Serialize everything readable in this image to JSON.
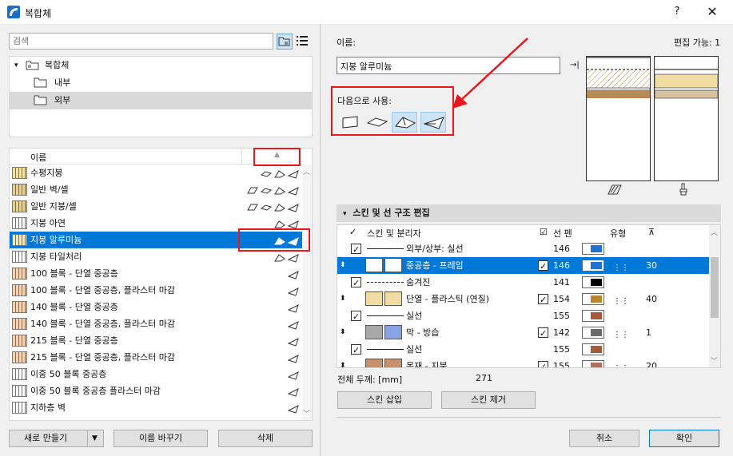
{
  "window": {
    "title": "복합체",
    "help": "?",
    "close": "✕"
  },
  "search": {
    "placeholder": "검색"
  },
  "tree": {
    "root": "복합체",
    "children": [
      "내부",
      "외부"
    ]
  },
  "list": {
    "header": "이름",
    "rows": [
      {
        "name": "수평지붕",
        "icons": 3
      },
      {
        "name": "일반 벽/셸",
        "icons": 4
      },
      {
        "name": "일반 지붕/셸",
        "icons": 4
      },
      {
        "name": "지붕 아연",
        "icons": 2
      },
      {
        "name": "지붕 알루미늄",
        "icons": 2,
        "selected": true
      },
      {
        "name": "지붕 타일처리",
        "icons": 2
      },
      {
        "name": "100 블록 - 단열 중공층",
        "icons": 1
      },
      {
        "name": "100 블록 - 단열 중공층, 플라스터 마감",
        "icons": 1
      },
      {
        "name": "140 블록 - 단열 중공층",
        "icons": 1
      },
      {
        "name": "140 블록 - 단열 중공층, 플라스터 마감",
        "icons": 1
      },
      {
        "name": "215 블록 - 단열 중공층",
        "icons": 1
      },
      {
        "name": "215 블록 - 단열 중공층, 플라스터 마감",
        "icons": 1
      },
      {
        "name": "이중 50 블록 중공층",
        "icons": 1
      },
      {
        "name": "이중 50 블록 중공층 플라스터 마감",
        "icons": 1
      },
      {
        "name": "지하층 벽",
        "icons": 1
      }
    ]
  },
  "buttons": {
    "new": "새로 만들기",
    "rename": "이름 바꾸기",
    "delete": "삭제",
    "insert_skin": "스킨 삽입",
    "remove_skin": "스킨 제거",
    "cancel": "취소",
    "ok": "확인"
  },
  "details": {
    "name_label": "이름:",
    "editable": "편집 가능: 1",
    "name_value": "지붕 알루미늄",
    "use_as_label": "다음으로 사용:"
  },
  "skins": {
    "section_title": "스킨 및 선 구조 편집",
    "columns": {
      "skin": "스킨 및 분리자",
      "pen": "선 펜",
      "type": "유형"
    },
    "rows": [
      {
        "label": "외부/상부: 실선",
        "pen": "146",
        "kind": "line"
      },
      {
        "label": "중공층 - 프레임",
        "pen": "146",
        "type_value": "30",
        "kind": "skin",
        "selected": true
      },
      {
        "label": "숨겨진",
        "pen": "141",
        "kind": "line-dashed"
      },
      {
        "label": "단열 - 플라스틱 (연질)",
        "pen": "154",
        "type_value": "40",
        "kind": "skin"
      },
      {
        "label": "실선",
        "pen": "155",
        "kind": "line"
      },
      {
        "label": "막 - 방습",
        "pen": "142",
        "type_value": "1",
        "kind": "skin"
      },
      {
        "label": "실선",
        "pen": "155",
        "kind": "line"
      },
      {
        "label": "목재 - 지붕",
        "pen": "155",
        "type_value": "20",
        "kind": "skin"
      }
    ],
    "total_label": "전체 두께: [mm]",
    "total_value": "271"
  },
  "colors": {
    "accent": "#0078d7",
    "highlight": "#e8161e"
  }
}
